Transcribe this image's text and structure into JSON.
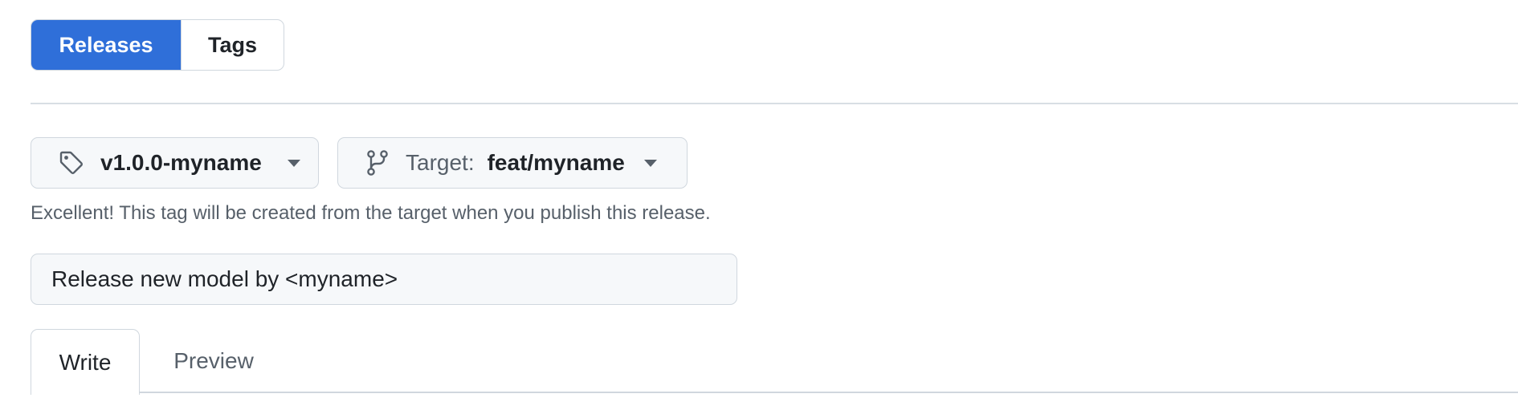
{
  "segmented": {
    "releases_label": "Releases",
    "tags_label": "Tags"
  },
  "tag_selector": {
    "value": "v1.0.0-myname",
    "icon": "tag-icon"
  },
  "target_selector": {
    "prefix": "Target:",
    "value": "feat/myname",
    "icon": "git-branch-icon"
  },
  "hint_text": "Excellent! This tag will be created from the target when you publish this release.",
  "release_title_input": {
    "value": "Release new model by <myname>"
  },
  "editor_tabs": {
    "write_label": "Write",
    "preview_label": "Preview"
  },
  "colors": {
    "accent": "#2f6fd9",
    "muted_text": "#57606a",
    "border": "#d0d7de",
    "button_bg": "#f6f8fa"
  }
}
